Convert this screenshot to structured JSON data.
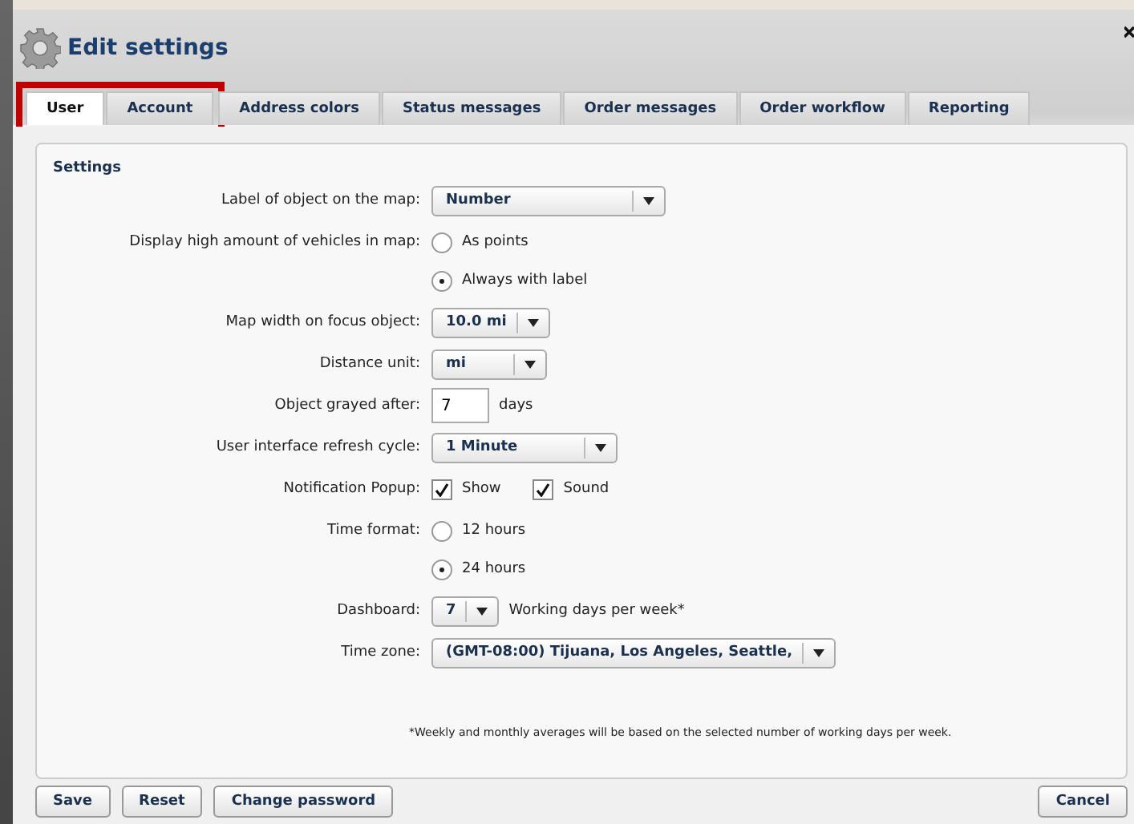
{
  "window": {
    "title": "Edit settings"
  },
  "tabs": [
    {
      "label": "User",
      "selected": true,
      "highlighted": true
    },
    {
      "label": "Account",
      "selected": false,
      "highlighted": true
    },
    {
      "label": "Address colors",
      "selected": false,
      "highlighted": false
    },
    {
      "label": "Status messages",
      "selected": false,
      "highlighted": false
    },
    {
      "label": "Order messages",
      "selected": false,
      "highlighted": false
    },
    {
      "label": "Order workflow",
      "selected": false,
      "highlighted": false
    },
    {
      "label": "Reporting",
      "selected": false,
      "highlighted": false
    }
  ],
  "section_title": "Settings",
  "fields": [
    {
      "kind": "select",
      "label": "Label of object on the map:",
      "value": "Number"
    },
    {
      "kind": "radio",
      "label": "Display high amount of vehicles in map:",
      "options": [
        {
          "label": "As points",
          "selected": false
        },
        {
          "label": "Always with label",
          "selected": true
        }
      ]
    },
    {
      "kind": "select",
      "label": "Map width on focus object:",
      "value": "10.0 mi"
    },
    {
      "kind": "select",
      "label": "Distance unit:",
      "value": "mi"
    },
    {
      "kind": "number",
      "label": "Object grayed after:",
      "value": "7",
      "unit": "days"
    },
    {
      "kind": "select",
      "label": "User interface refresh cycle:",
      "value": "1 Minute"
    },
    {
      "kind": "checks",
      "label": "Notification Popup:",
      "options": [
        {
          "label": "Show",
          "checked": true
        },
        {
          "label": "Sound",
          "checked": true
        }
      ]
    },
    {
      "kind": "radio",
      "label": "Time format:",
      "options": [
        {
          "label": "12 hours",
          "selected": false
        },
        {
          "label": "24 hours",
          "selected": true
        }
      ]
    },
    {
      "kind": "select",
      "label": "Dashboard:",
      "value": "7",
      "suffix": "Working days per week*"
    },
    {
      "kind": "select",
      "label": "Time zone:",
      "value": "(GMT-08:00) Tijuana, Los Angeles, Seattle,"
    }
  ],
  "footnote": "*Weekly and monthly averages will be based on the selected number of working days per week.",
  "buttons": [
    "Save",
    "Reset",
    "Change password"
  ],
  "cancel_button": "Cancel"
}
